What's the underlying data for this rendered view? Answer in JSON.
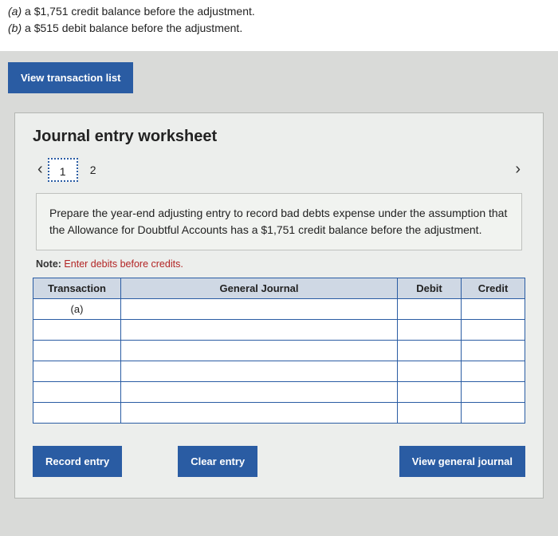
{
  "prompt": {
    "a": {
      "label": "(a)",
      "text": "a $1,751 credit balance before the adjustment."
    },
    "b": {
      "label": "(b)",
      "text": "a $515 debit balance before the adjustment."
    }
  },
  "buttons": {
    "view_transaction_list": "View transaction list",
    "record_entry": "Record entry",
    "clear_entry": "Clear entry",
    "view_general_journal": "View general journal"
  },
  "worksheet": {
    "title": "Journal entry worksheet",
    "pages": {
      "p1": "1",
      "p2": "2"
    },
    "instruction": "Prepare the year-end adjusting entry to record bad debts expense under the assumption that the Allowance for Doubtful Accounts has a $1,751 credit balance before the adjustment.",
    "note_label": "Note:",
    "note_text": " Enter debits before credits.",
    "headers": {
      "transaction": "Transaction",
      "general_journal": "General Journal",
      "debit": "Debit",
      "credit": "Credit"
    },
    "rows": [
      {
        "transaction": "(a)",
        "gj": "",
        "debit": "",
        "credit": ""
      },
      {
        "transaction": "",
        "gj": "",
        "debit": "",
        "credit": ""
      },
      {
        "transaction": "",
        "gj": "",
        "debit": "",
        "credit": ""
      },
      {
        "transaction": "",
        "gj": "",
        "debit": "",
        "credit": ""
      },
      {
        "transaction": "",
        "gj": "",
        "debit": "",
        "credit": ""
      },
      {
        "transaction": "",
        "gj": "",
        "debit": "",
        "credit": ""
      }
    ]
  }
}
